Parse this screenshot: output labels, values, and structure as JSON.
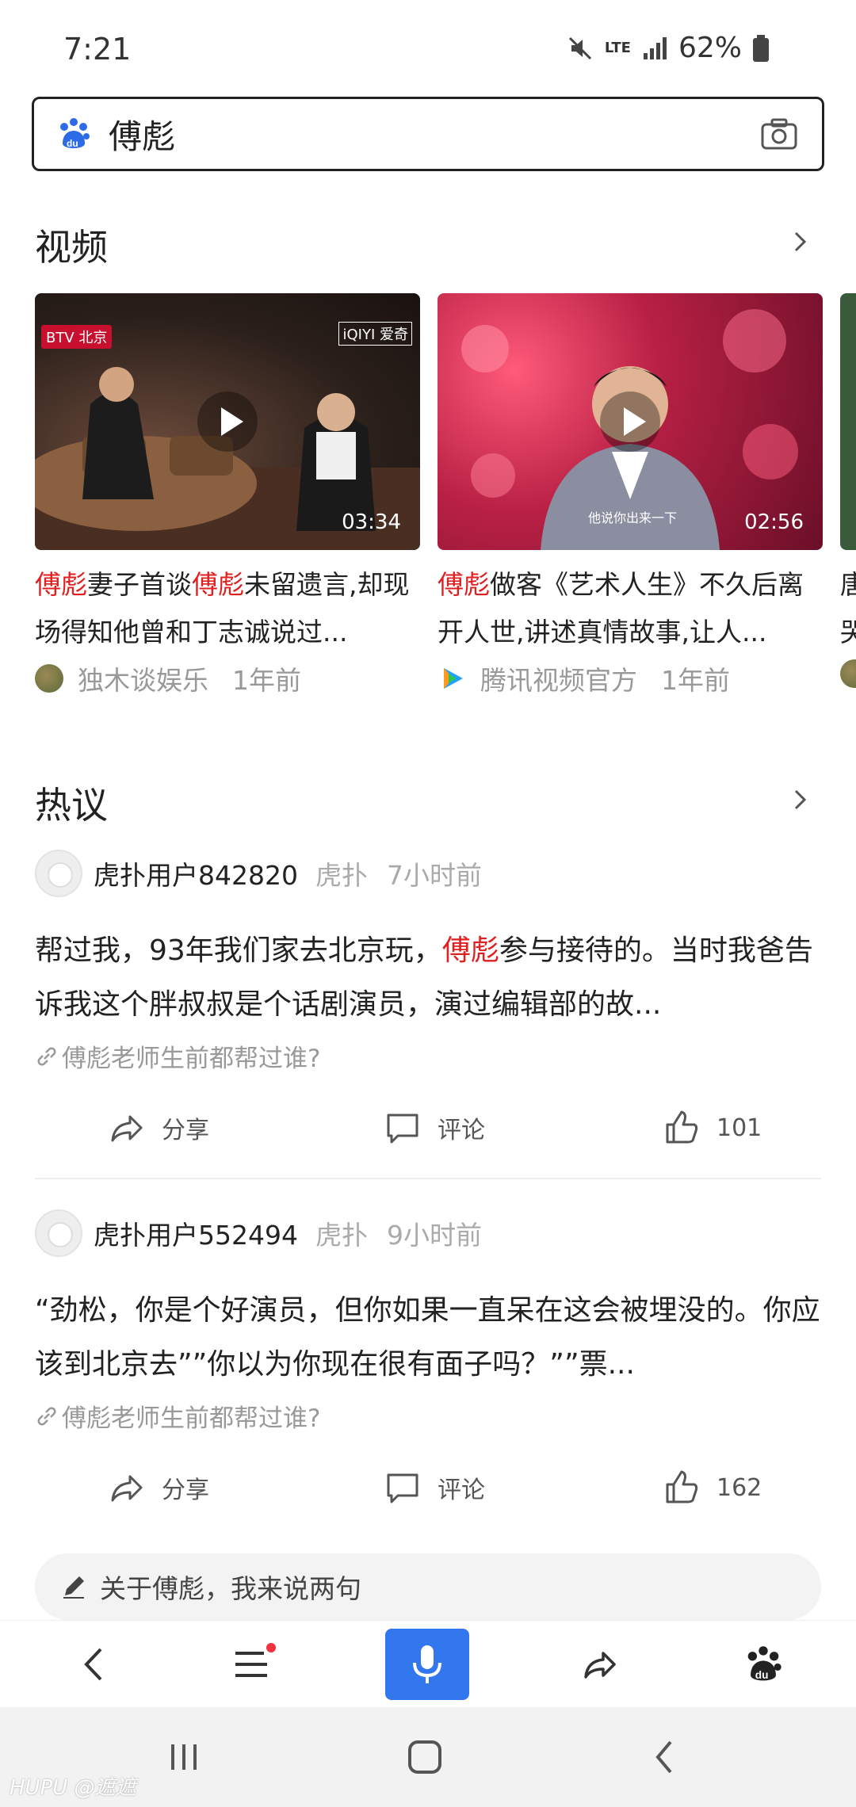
{
  "status_bar": {
    "time": "7:21",
    "network": "LTE",
    "battery": "62%"
  },
  "search": {
    "query": "傅彪"
  },
  "videos_section": {
    "title": "视频",
    "items": [
      {
        "duration": "03:34",
        "badge_left": "BTV 北京",
        "badge_right": "iQIYI 爱奇",
        "title_parts": [
          "傅彪",
          "妻子首谈",
          "傅彪",
          "未留遗言,却现场得知他曾和丁志诚说过..."
        ],
        "author": "独木谈娱乐",
        "time": "1年前"
      },
      {
        "duration": "02:56",
        "caption": "他说你出来一下",
        "title_parts": [
          "傅彪",
          "做客《艺术人生》不久后离开人世,讲述真情故事,让人..."
        ],
        "author": "腾讯视频官方",
        "time": "1年前"
      },
      {
        "title_parts": [
          "唐",
          "哭"
        ]
      }
    ]
  },
  "hot_section": {
    "title": "热议",
    "posts": [
      {
        "user": "虎扑用户842820",
        "source": "虎扑",
        "time": "7小时前",
        "body_before": "帮过我，93年我们家去北京玩，",
        "body_highlight": "傅彪",
        "body_after": "参与接待的。当时我爸告诉我这个胖叔叔是个话剧演员，演过编辑部的故...",
        "topic": "傅彪老师生前都帮过谁?",
        "share_label": "分享",
        "comment_label": "评论",
        "likes": "101"
      },
      {
        "user": "虎扑用户552494",
        "source": "虎扑",
        "time": "9小时前",
        "body_before": "“劲松，你是个好演员，但你如果一直呆在这会被埋没的。你应该到北京去””你以为你现在很有面子吗？””票...",
        "body_highlight": "",
        "body_after": "",
        "topic": "傅彪老师生前都帮过谁?",
        "share_label": "分享",
        "comment_label": "评论",
        "likes": "162"
      }
    ]
  },
  "comment_entry": {
    "placeholder": "关于傅彪，我来说两句"
  },
  "toolbar": {
    "icons": [
      "back-icon",
      "menu-icon",
      "microphone-icon",
      "share-icon",
      "baidu-paw-icon"
    ]
  },
  "navbar": {
    "icons": [
      "recent-apps-icon",
      "home-icon",
      "back-icon"
    ]
  },
  "watermark": {
    "text": "HUPU @遮遮"
  },
  "colors": {
    "highlight": "#e02020",
    "mic_button": "#3377ee",
    "meta": "#999999"
  }
}
